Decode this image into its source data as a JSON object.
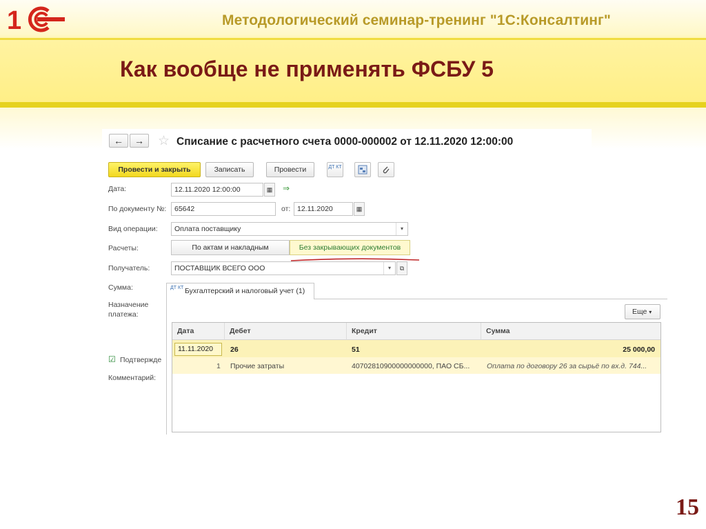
{
  "slide": {
    "seminar": "Методологический семинар-тренинг \"1С:Консалтинг\"",
    "title": "Как вообще не применять ФСБУ 5",
    "page": "15"
  },
  "window": {
    "title": "Списание с расчетного счета 0000-000002 от 12.11.2020 12:00:00",
    "back": "←",
    "forward": "→",
    "star": "☆"
  },
  "toolbar": {
    "post_close": "Провести и закрыть",
    "save": "Записать",
    "post": "Провести",
    "dt_kt": "ДТ КТ"
  },
  "form": {
    "date_label": "Дата:",
    "date_value": "12.11.2020 12:00:00",
    "doc_label": "По документу №:",
    "doc_value": "65642",
    "from_label": "от:",
    "from_value": "12.11.2020",
    "operation_label": "Вид операции:",
    "operation_value": "Оплата поставщику",
    "settlements_label": "Расчеты:",
    "seg_acts": "По актам и накладным",
    "seg_none": "Без закрывающих документов",
    "recipient_label": "Получатель:",
    "recipient_value": "ПОСТАВЩИК ВСЕГО ООО",
    "sum_label": "Сумма:",
    "purpose_label1": "Назначение",
    "purpose_label2": "платежа:",
    "confirm_label": "Подтвержде",
    "comment_label": "Комментарий:"
  },
  "tab": {
    "label": "Бухгалтерский и налоговый учет (1)",
    "icon": "ДТ КТ"
  },
  "more": "Еще",
  "table": {
    "headers": [
      "Дата",
      "Дебет",
      "Кредит",
      "Сумма"
    ],
    "row1": {
      "date": "11.11.2020",
      "debit": "26",
      "credit": "51",
      "sum": "25 000,00"
    },
    "row2": {
      "num": "1",
      "debit": "Прочие затраты",
      "credit": "40702810900000000000, ПАО СБ...",
      "sum": "Оплата по договору 26 за сырьё по вх.д. 744..."
    }
  },
  "colors": {
    "title": "#7a1a16",
    "seminar": "#b89a28",
    "accent": "#f2d81e"
  }
}
